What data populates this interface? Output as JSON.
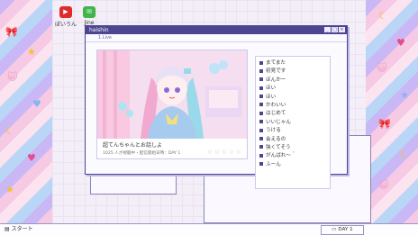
{
  "desktop": {
    "icons": [
      {
        "label": "ぽいうん",
        "glyph": "▶",
        "color": "#e02b2b"
      },
      {
        "label": "Jine",
        "glyph": "✉",
        "color": "#3fb54a"
      }
    ]
  },
  "window": {
    "title": "haishin",
    "address": "1.Live"
  },
  "stream": {
    "title": "超てんちゃんとお話しよ",
    "viewers": "1025 人が視聴中・配信開始日時：DAY 1"
  },
  "comments": [
    "まてまた",
    "初見です",
    "ほんかー",
    "ほい",
    "ほい",
    "かわいい",
    "はじめて",
    "いいじゃん",
    "うける",
    "会えるの",
    "強くてそう",
    "がんばれ～＾",
    "ふーん"
  ],
  "taskbar": {
    "start_label": "スタート",
    "day_label": "DAY 1"
  },
  "colors": {
    "accent": "#4c4690",
    "pink": "#f6c9e4",
    "lavender": "#c9b8f5"
  }
}
